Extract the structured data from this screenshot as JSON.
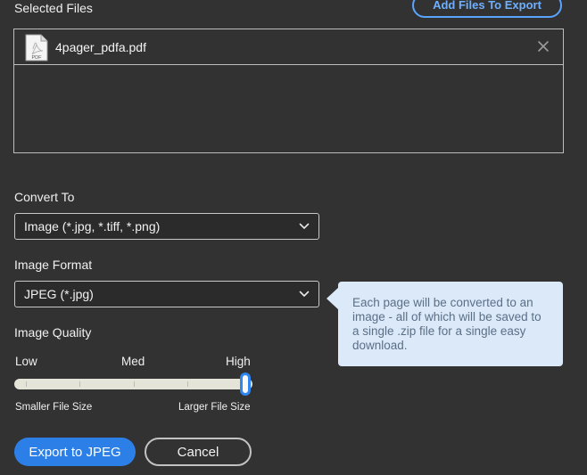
{
  "selected_files": {
    "label": "Selected Files",
    "add_button_label": "Add Files To Export",
    "files": [
      {
        "name": "4pager_pdfa.pdf",
        "icon": "pdf-file-icon",
        "icon_text": "PDF"
      }
    ]
  },
  "convert_to": {
    "label": "Convert To",
    "selected": "Image (*.jpg, *.tiff, *.png)"
  },
  "image_format": {
    "label": "Image Format",
    "selected": "JPEG (*.jpg)"
  },
  "tooltip": {
    "text": "Each page will be converted to an image - all of which will be saved to a single .zip file for a single easy download."
  },
  "image_quality": {
    "label": "Image Quality",
    "levels": [
      "Low",
      "Med",
      "High"
    ],
    "value_fraction": 1.0,
    "min_label": "Smaller File Size",
    "max_label": "Larger File Size"
  },
  "actions": {
    "export_label": "Export to JPEG",
    "cancel_label": "Cancel"
  },
  "colors": {
    "background": "#323232",
    "accent": "#2d7fe8",
    "tooltip_bg": "#dbe9f9",
    "tooltip_text": "#5b6f87"
  }
}
